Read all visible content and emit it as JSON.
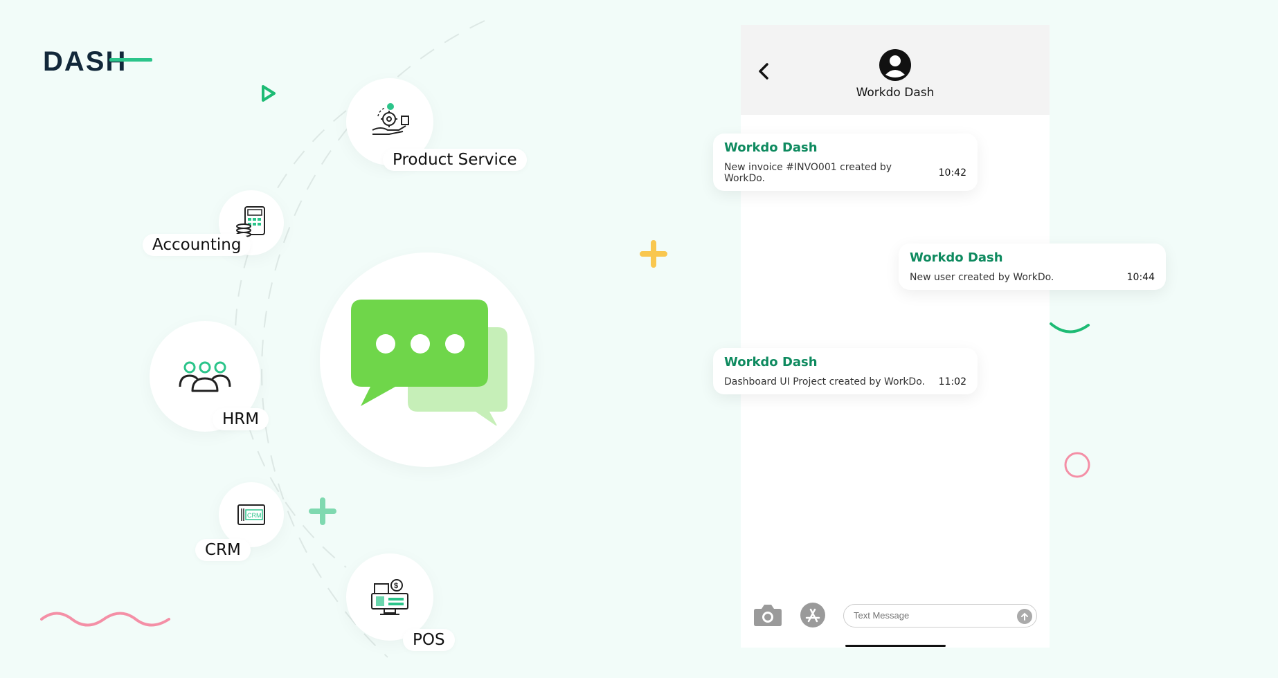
{
  "brand": {
    "logo_text": "DASH"
  },
  "modules": [
    {
      "label": "Product Service",
      "icon": "product-service-icon"
    },
    {
      "label": "Accounting",
      "icon": "accounting-icon"
    },
    {
      "label": "HRM",
      "icon": "team-icon"
    },
    {
      "label": "CRM",
      "icon": "crm-icon"
    },
    {
      "label": "POS",
      "icon": "pos-icon"
    }
  ],
  "center_icon": "chat-bubbles-icon",
  "phone": {
    "contact_name": "Workdo Dash",
    "messages": [
      {
        "sender": "Workdo Dash",
        "text": "New invoice #INVO001 created by WorkDo.",
        "time": "10:42"
      },
      {
        "sender": "Workdo Dash",
        "text": "New user created by WorkDo.",
        "time": "10:44"
      },
      {
        "sender": "Workdo Dash",
        "text": "Dashboard UI Project created by WorkDo.",
        "time": "11:02"
      }
    ],
    "input_placeholder": "Text Message"
  },
  "colors": {
    "accent_green": "#0e8a5f",
    "chat_green": "#6fd64a",
    "chat_light_green": "#c6efb8",
    "logo_dark": "#12283a",
    "logo_green": "#2bc48a",
    "deco_yellow": "#f9c74f",
    "deco_pink": "#f48fa6",
    "deco_mint": "#7fd9b0"
  }
}
